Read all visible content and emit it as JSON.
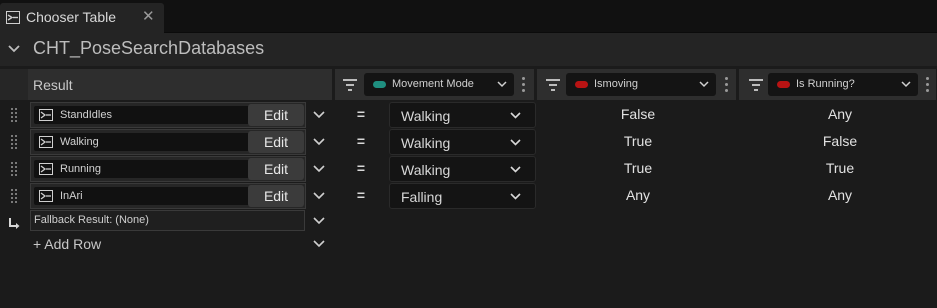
{
  "tab": {
    "label": "Chooser Table",
    "close_glyph": "✕",
    "icon": "chooser-table-icon"
  },
  "asset": {
    "name": "CHT_PoseSearchDatabases"
  },
  "columns": {
    "result": {
      "label": "Result"
    },
    "movement_mode": {
      "label": "Movement Mode",
      "color": "#1f8f80"
    },
    "ismoving": {
      "label": "Ismoving",
      "color": "#b81313"
    },
    "is_running": {
      "label": "Is Running?",
      "color": "#b81313"
    }
  },
  "rows": [
    {
      "result": "StandIdles",
      "edit": "Edit",
      "op": "=",
      "movement_mode": "Walking",
      "ismoving": "False",
      "is_running": "Any"
    },
    {
      "result": "Walking",
      "edit": "Edit",
      "op": "=",
      "movement_mode": "Walking",
      "ismoving": "True",
      "is_running": "False"
    },
    {
      "result": "Running",
      "edit": "Edit",
      "op": "=",
      "movement_mode": "Walking",
      "ismoving": "True",
      "is_running": "True"
    },
    {
      "result": "InAri",
      "edit": "Edit",
      "op": "=",
      "movement_mode": "Falling",
      "ismoving": "Any",
      "is_running": "Any"
    }
  ],
  "fallback": {
    "label": "Fallback Result: (None)"
  },
  "add_row": {
    "label": "+ Add Row"
  },
  "colors": {
    "background": "#1b1b1b",
    "header": "#242424",
    "column_header": "#2e2e2e"
  }
}
